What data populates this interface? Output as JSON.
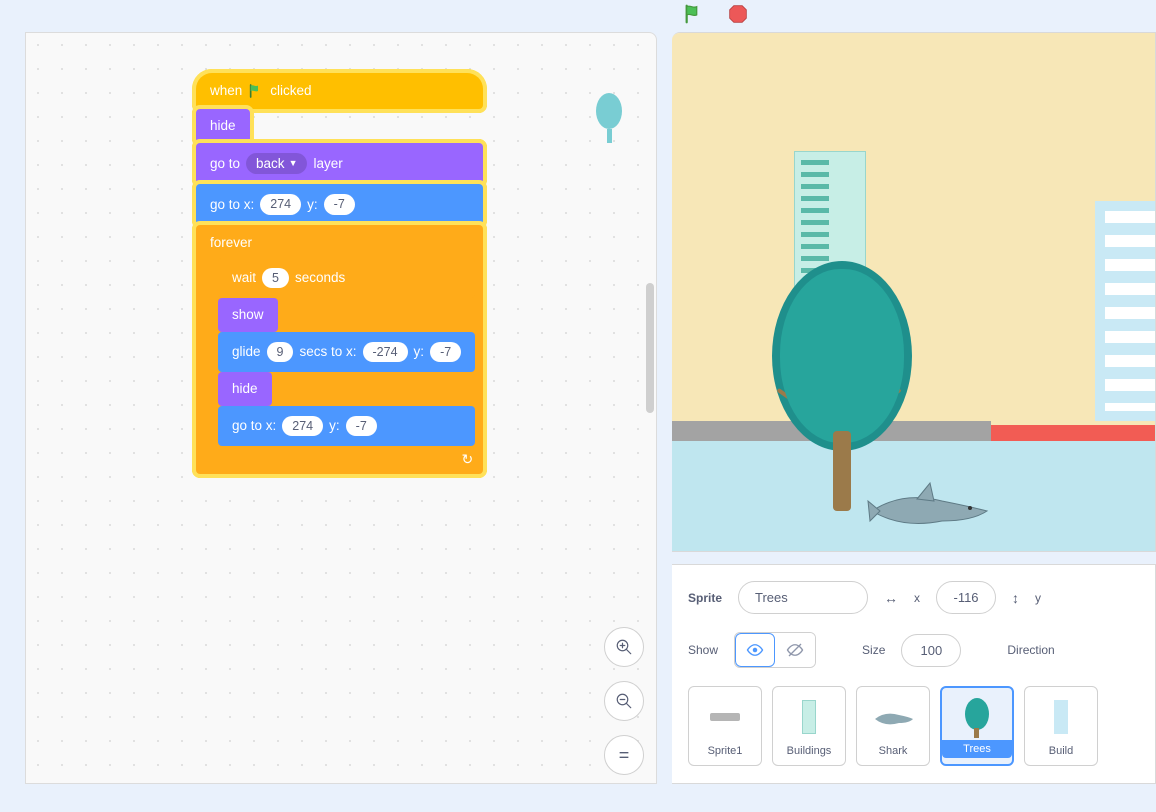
{
  "controls": {
    "green_flag": "green-flag",
    "stop": "stop"
  },
  "blocks": {
    "when_clicked_pre": "when",
    "when_clicked_post": "clicked",
    "hide": "hide",
    "goto_layer_pre": "go to",
    "goto_layer_option": "back",
    "goto_layer_post": "layer",
    "goto_xy_pre": "go to x:",
    "goto_xy_mid": "y:",
    "goto_x1": "274",
    "goto_y1": "-7",
    "forever": "forever",
    "wait_pre": "wait",
    "wait_secs": "5",
    "wait_post": "seconds",
    "show": "show",
    "glide_pre": "glide",
    "glide_secs": "9",
    "glide_mid": "secs to x:",
    "glide_x": "-274",
    "glide_y_label": "y:",
    "glide_y": "-7",
    "hide2": "hide",
    "goto_x2": "274",
    "goto_y2": "-7"
  },
  "zoom": {
    "in": "+",
    "out": "−",
    "reset": "="
  },
  "sprite_info": {
    "sprite_label": "Sprite",
    "sprite_name": "Trees",
    "x_label": "x",
    "x_value": "-116",
    "y_label": "y",
    "show_label": "Show",
    "size_label": "Size",
    "size_value": "100",
    "direction_label": "Direction"
  },
  "sprites": [
    {
      "name": "Sprite1"
    },
    {
      "name": "Buildings"
    },
    {
      "name": "Shark"
    },
    {
      "name": "Trees",
      "selected": true
    },
    {
      "name": "Build"
    }
  ]
}
